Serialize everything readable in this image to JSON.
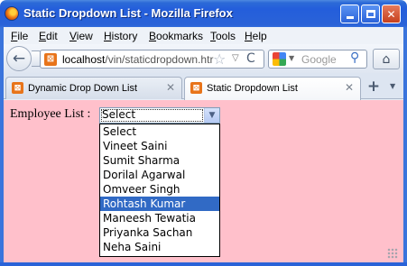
{
  "window": {
    "title": "Static Dropdown List - Mozilla Firefox",
    "buttons": {
      "minimize": "minimize",
      "maximize": "maximize",
      "close": "✕"
    }
  },
  "menu": [
    "File",
    "Edit",
    "View",
    "History",
    "Bookmarks",
    "Tools",
    "Help"
  ],
  "navbar": {
    "url_host": "localhost",
    "url_path": "/vin/staticdropdown.htr",
    "search_placeholder": "Google",
    "back_glyph": "←",
    "reload_glyph": "C",
    "star_glyph": "☆",
    "drop_glyph": "▽",
    "search_glyph": "⚲",
    "home_glyph": "⌂"
  },
  "tabs": [
    {
      "label": "Dynamic Drop Down List",
      "active": false
    },
    {
      "label": "Static Dropdown List",
      "active": true
    }
  ],
  "tabbar": {
    "close_glyph": "✕",
    "new_tab_glyph": "+",
    "all_tabs_glyph": "▼"
  },
  "page": {
    "background": "#ffc0cb",
    "label": "Employee List :",
    "select": {
      "value": "Select",
      "arrow_glyph": "▼",
      "options": [
        "Select",
        "Vineet Saini",
        "Sumit Sharma",
        "Dorilal Agarwal",
        "Omveer Singh",
        "Rohtash Kumar",
        "Maneesh Tewatia",
        "Priyanka Sachan",
        "Neha Saini"
      ],
      "highlighted_option": "Rohtash Kumar"
    }
  },
  "colors": {
    "titlebar": "#245edb",
    "highlight": "#316ac5",
    "page_bg": "#ffc0cb"
  },
  "icons": {
    "app": "firefox-icon",
    "site": "xampp-icon",
    "search_engine": "google-icon"
  }
}
